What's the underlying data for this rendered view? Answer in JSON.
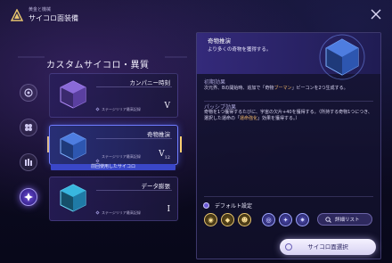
{
  "header": {
    "subtitle": "黄金と機械",
    "title": "サイコロ面装備"
  },
  "left": {
    "section_title": "カスタムサイコロ・異質",
    "cards": [
      {
        "name": "カンパニー時刻",
        "stage": "ステージリリア最高記録",
        "roman": "V",
        "roman_sub": ""
      },
      {
        "name": "奇物推演",
        "stage": "ステージリリア最高記録",
        "roman": "V",
        "roman_sub": "12"
      },
      {
        "name": "データ膨張",
        "stage": "ステージリリア最高記録",
        "roman": "I",
        "roman_sub": ""
      }
    ],
    "used_label": "前回使用したサイコロ"
  },
  "detail": {
    "name": "奇物推演",
    "desc": "より多くの奇物を獲得する。",
    "initial_heading": "初期効果",
    "initial_text_1": "次元界、Bの開始時、追加で「奇物",
    "initial_text_hl": "ブーマン",
    "initial_text_2": "」ビーコンを2つ生成する。",
    "passive_heading": "パッシブ効果",
    "passive_text_1": "奇物を1つ獲得するたびに、宇宙の欠片+40を獲得する。（所持する奇物1つにつき、選択した運命の「",
    "passive_text_hl": "運命強化",
    "passive_text_2": "」効果を獲得する。）"
  },
  "defaults": {
    "label": "デフォルト設定",
    "list_button": "詳細リスト"
  },
  "actions": {
    "select": "サイコロ面選択"
  },
  "colors": {
    "accent": "#6f7cff",
    "highlight": "#f2b86a",
    "gold": "#e8c56e"
  }
}
